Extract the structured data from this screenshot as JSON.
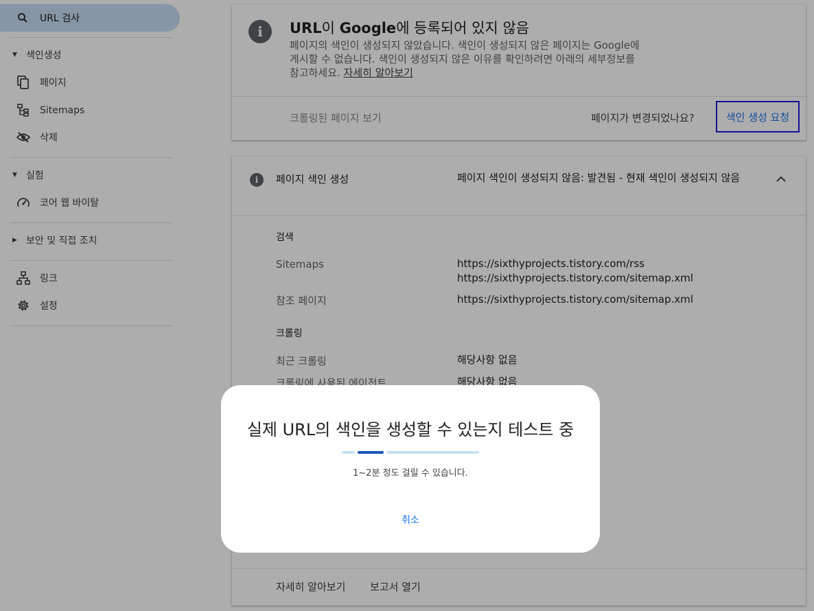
{
  "sidebar": {
    "active_item": {
      "label": "URL 검사",
      "icon": "search-icon"
    },
    "sections": [
      {
        "label": "색인생성",
        "expanded": true,
        "items": [
          {
            "label": "페이지",
            "icon": "pages-icon"
          },
          {
            "label": "Sitemaps",
            "icon": "sitemap-icon"
          },
          {
            "label": "삭제",
            "icon": "visibility-off-icon"
          }
        ]
      },
      {
        "label": "실험",
        "expanded": true,
        "items": [
          {
            "label": "코어 웹 바이탈",
            "icon": "speedometer-icon"
          }
        ]
      },
      {
        "label": "보안 및 직접 조치",
        "expanded": false,
        "items": []
      }
    ],
    "bottom_items": [
      {
        "label": "링크",
        "icon": "links-icon"
      },
      {
        "label": "설정",
        "icon": "settings-icon"
      }
    ]
  },
  "status_card": {
    "title_prefix": "URL",
    "title_mid": "이 ",
    "title_brand": "Google",
    "title_suffix": "에 등록되어 있지 않음",
    "description_line1": "페이지의 색인이 생성되지 않았습니다. 색인이 생성되지 않은 페이지는 Google에",
    "description_line2": "게시할 수 없습니다. 색인이 생성되지 않은 이유를 확인하려면 아래의 세부정보를",
    "description_line3": "참고하세요. ",
    "learn_more": "자세히 알아보기",
    "view_crawled": "크롤링된 페이지 보기",
    "page_changed": "페이지가 변경되었나요?",
    "request_indexing": "색인 생성 요청"
  },
  "indexing_card": {
    "header_label": "페이지 색인 생성",
    "header_value": "페이지 색인이 생성되지 않음: 발견됨 - 현재 색인이 생성되지 않음",
    "discovery_heading": "검색",
    "sitemaps_label": "Sitemaps",
    "sitemaps_values": [
      "https://sixthyprojects.tistory.com/rss",
      "https://sixthyprojects.tistory.com/sitemap.xml"
    ],
    "referring_label": "참조 페이지",
    "referring_value": "https://sixthyprojects.tistory.com/sitemap.xml",
    "crawl_heading": "크롤링",
    "last_crawl_label": "최근 크롤링",
    "last_crawl_value": "해당사항 없음",
    "crawled_as_label": "크롤링에 사용된 에이전트",
    "crawled_as_value": "해당사항 없음",
    "footer_learn_more": "자세히 알아보기",
    "footer_open_report": "보고서 열기"
  },
  "dialog": {
    "title": "실제 URL의 색인을 생성할 수 있는지 테스트 중",
    "subtitle": "1~2분 정도 걸릴 수 있습니다.",
    "cancel": "취소"
  },
  "colors": {
    "accent": "#1a73e8",
    "progress_active": "#1a56b8",
    "progress_track": "#c6e1f2",
    "nav_active_bg": "#c7ddf5",
    "focus_outline": "#1a1ad6"
  }
}
